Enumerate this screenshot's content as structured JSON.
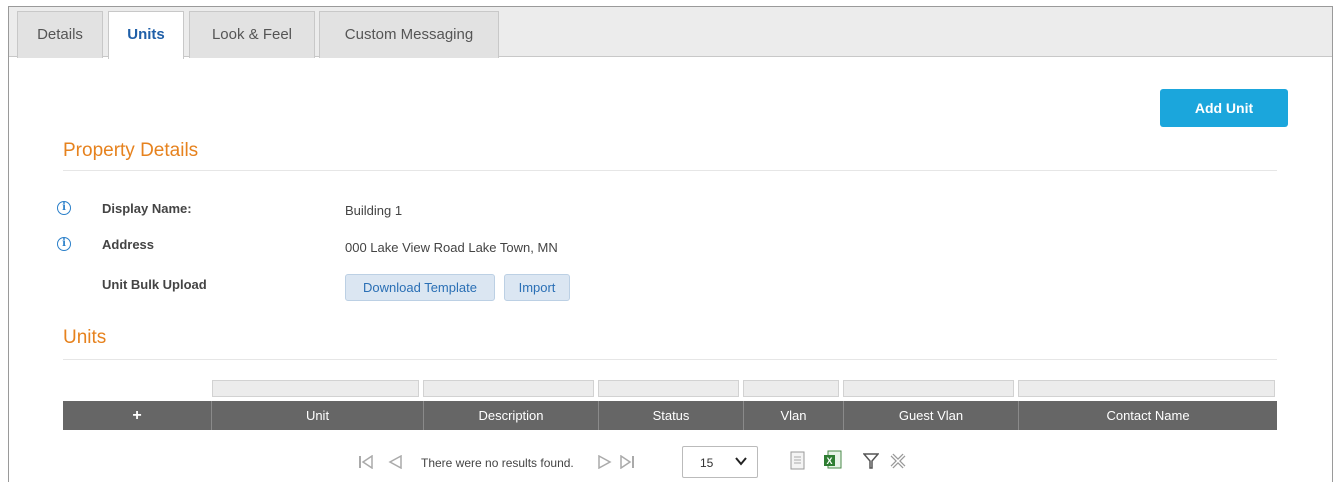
{
  "tabs": [
    {
      "label": "Details"
    },
    {
      "label": "Units"
    },
    {
      "label": "Look & Feel"
    },
    {
      "label": "Custom Messaging"
    }
  ],
  "active_tab": "Units",
  "toolbar": {
    "add_unit_label": "Add Unit"
  },
  "property_details": {
    "title": "Property Details",
    "display_name_label": "Display Name:",
    "display_name_value": "Building 1",
    "address_label": "Address",
    "address_value": "000 Lake View Road Lake Town, MN",
    "bulk_upload_label": "Unit Bulk Upload",
    "download_template_label": "Download Template",
    "import_label": "Import"
  },
  "units": {
    "title": "Units",
    "columns": [
      "+",
      "Unit",
      "Description",
      "Status",
      "Vlan",
      "Guest Vlan",
      "Contact Name"
    ],
    "rows": []
  },
  "pager": {
    "message": "There were no results found.",
    "page_size": "15"
  },
  "icons": {
    "info": "info-icon",
    "first": "first-page-icon",
    "prev": "prev-page-icon",
    "next": "next-page-icon",
    "last": "last-page-icon",
    "export_csv": "document-icon",
    "export_excel": "excel-icon",
    "filter": "filter-icon",
    "clear_filter": "clear-filter-icon"
  },
  "colors": {
    "accent": "#e6821e",
    "primary_button": "#1ba6dc",
    "table_header": "#666666",
    "link": "#2a6fb5"
  }
}
